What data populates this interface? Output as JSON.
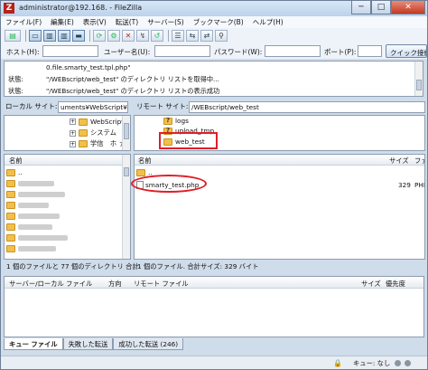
{
  "window": {
    "title": "administrator@192.168.   - FileZilla",
    "close": "✕",
    "minimize": "─",
    "maximize": "□"
  },
  "menu": [
    "ファイル(F)",
    "編集(E)",
    "表示(V)",
    "転送(T)",
    "サーバー(S)",
    "ブックマーク(B)",
    "ヘルプ(H)"
  ],
  "toolbar": [
    "site-manager-icon",
    "toggle-log-icon",
    "toggle-tree-icon",
    "toggle-remote-tree-icon",
    "toggle-queue-icon",
    "refresh-icon",
    "process-queue-icon",
    "cancel-icon",
    "disconnect-icon",
    "reconnect-icon",
    "filter-icon",
    "compare-icon",
    "sync-browse-icon",
    "search-icon"
  ],
  "quickconnect": {
    "host_label": "ホスト(H):",
    "user_label": "ユーザー名(U):",
    "pass_label": "パスワード(W):",
    "port_label": "ポート(P):",
    "button": "クイック接続"
  },
  "log": [
    {
      "status": "",
      "text": "0.file.smarty_test.tpl.php\""
    },
    {
      "status": "状態:",
      "text": "\"/WEBscript/web_test\" のディレクトリ リストを取得中..."
    },
    {
      "status": "状態:",
      "text": "\"/WEBscript/web_test\" のディレクトリ リストの表示成功"
    }
  ],
  "local": {
    "site_label": "ローカル サイト:",
    "site_value": "uments¥WebScript¥",
    "tree": [
      "WebScript",
      "システム",
      "学信　ホ ァ"
    ],
    "col_name": "名前",
    "files": [
      ".."
    ],
    "status": "1 個のファイルと 77 個のディレクトリ 合計"
  },
  "remote": {
    "site_label": "リモート サイト:",
    "site_value": "/WEBscript/web_test",
    "tree": [
      "logs",
      "upload_tmp",
      "web_test"
    ],
    "col_name": "名前",
    "col_size": "サイズ",
    "col_type": "ファ",
    "files": [
      {
        "name": "..",
        "size": "",
        "type": ""
      },
      {
        "name": "smarty_test.php",
        "size": "329",
        "type": "PHP"
      }
    ],
    "status": "1 個のファイル. 合計サイズ: 329 バイト"
  },
  "queue": {
    "cols": [
      "サーバー/ローカル ファイル",
      "方向",
      "リモート ファイル",
      "サイズ",
      "優先度"
    ],
    "tabs": [
      "キュー ファイル",
      "失敗した転送",
      "成功した転送 (246)"
    ],
    "status": "キュー: なし"
  }
}
